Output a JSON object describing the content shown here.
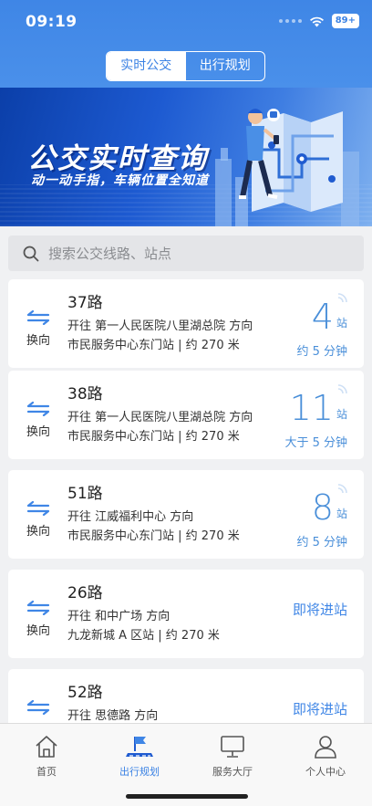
{
  "status": {
    "time": "09:19",
    "battery": "89+"
  },
  "segmented": {
    "realtime": "实时公交",
    "planning": "出行规划"
  },
  "banner": {
    "title": "公交实时查询",
    "subtitle": "动一动手指，车辆位置全知道"
  },
  "search": {
    "placeholder": "搜索公交线路、站点"
  },
  "swap_label": "换向",
  "routes": [
    {
      "name": "37路",
      "direction": "开往 第一人民医院八里湖总院 方向",
      "stop": "市民服务中心东门站 | 约 270 米",
      "stops_away": "4",
      "unit": "站",
      "eta": "约 5 分钟"
    },
    {
      "name": "38路",
      "direction": "开往 第一人民医院八里湖总院 方向",
      "stop": "市民服务中心东门站 | 约 270 米",
      "stops_away": "11",
      "unit": "站",
      "eta": "大于 5 分钟"
    },
    {
      "name": "51路",
      "direction": "开往 江威福利中心 方向",
      "stop": "市民服务中心东门站 | 约 270 米",
      "stops_away": "8",
      "unit": "站",
      "eta": "约 5 分钟"
    },
    {
      "name": "26路",
      "direction": "开往 和中广场 方向",
      "stop": "九龙新城 A 区站 | 约 270 米",
      "status": "即将进站"
    },
    {
      "name": "52路",
      "direction": "开往 思德路 方向",
      "status": "即将进站"
    }
  ],
  "tabs": [
    {
      "label": "首页",
      "icon": "home-icon"
    },
    {
      "label": "出行规划",
      "icon": "route-flag-icon"
    },
    {
      "label": "服务大厅",
      "icon": "monitor-icon"
    },
    {
      "label": "个人中心",
      "icon": "person-icon"
    }
  ],
  "colors": {
    "primary": "#3f86e6",
    "accent_text": "#4a8fd9",
    "background": "#f0f1f3"
  }
}
